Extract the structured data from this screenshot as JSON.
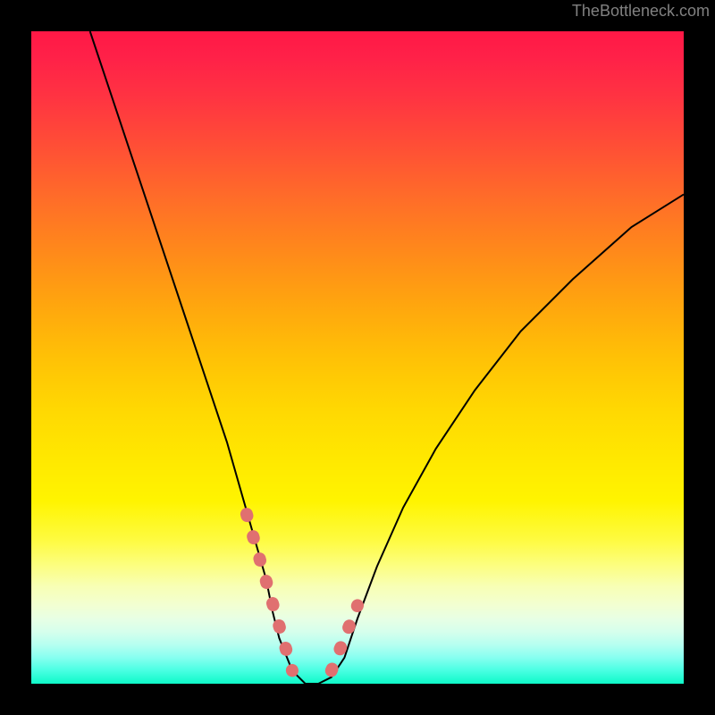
{
  "watermark": "TheBottleneck.com",
  "chart_data": {
    "type": "line",
    "title": "",
    "xlabel": "",
    "ylabel": "",
    "xlim": [
      0,
      100
    ],
    "ylim": [
      0,
      100
    ],
    "series": [
      {
        "name": "bottleneck-curve",
        "x": [
          9,
          12,
          15,
          18,
          21,
          24,
          27,
          30,
          32,
          34,
          36,
          37,
          38,
          40,
          42,
          44,
          46,
          48,
          50,
          53,
          57,
          62,
          68,
          75,
          83,
          92,
          100
        ],
        "y": [
          100,
          91,
          82,
          73,
          64,
          55,
          46,
          37,
          30,
          23,
          16,
          11,
          7,
          2,
          0,
          0,
          1,
          4,
          10,
          18,
          27,
          36,
          45,
          54,
          62,
          70,
          75
        ]
      },
      {
        "name": "highlight-range",
        "description": "thick salmon overlay segments near trough",
        "segments": [
          {
            "x": [
              33,
              40
            ],
            "y": [
              26,
              2
            ]
          },
          {
            "x": [
              46,
              50
            ],
            "y": [
              2,
              12
            ]
          }
        ]
      }
    ],
    "background_gradient": {
      "top": "#ff1846",
      "mid": "#ffe900",
      "bottom": "#0ef9c8"
    },
    "curve_style": {
      "stroke": "#000000",
      "stroke_width": 2
    },
    "highlight_style": {
      "stroke": "#e07070",
      "stroke_width": 14,
      "linecap": "round",
      "dash": "2 24"
    }
  }
}
